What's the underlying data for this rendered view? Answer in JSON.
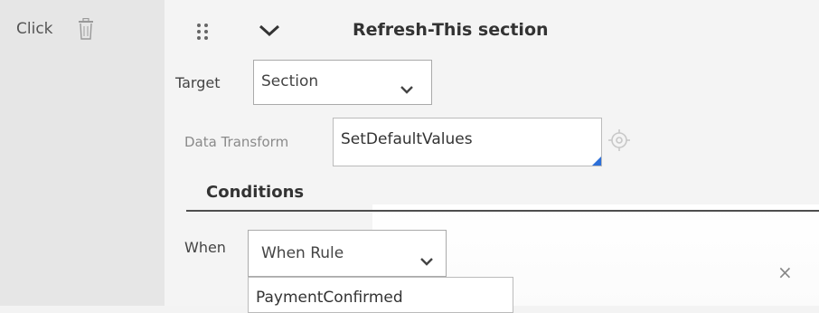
{
  "event": {
    "label": "Click",
    "delete_icon": "trash-icon"
  },
  "action": {
    "drag_icon": "drag-handle-icon",
    "collapse_icon": "chevron-down-icon",
    "title": "Refresh-This section",
    "target": {
      "label": "Target",
      "value": "Section"
    },
    "data_transform": {
      "label": "Data Transform",
      "value": "SetDefaultValues",
      "lookup_icon": "target-icon"
    }
  },
  "conditions": {
    "heading": "Conditions",
    "when_label": "When",
    "when_value": "When Rule",
    "rule_value": "PaymentConfirmed",
    "close_label": "×"
  },
  "colors": {
    "accent": "#2c6fd8",
    "divider": "#4e4e4e"
  }
}
